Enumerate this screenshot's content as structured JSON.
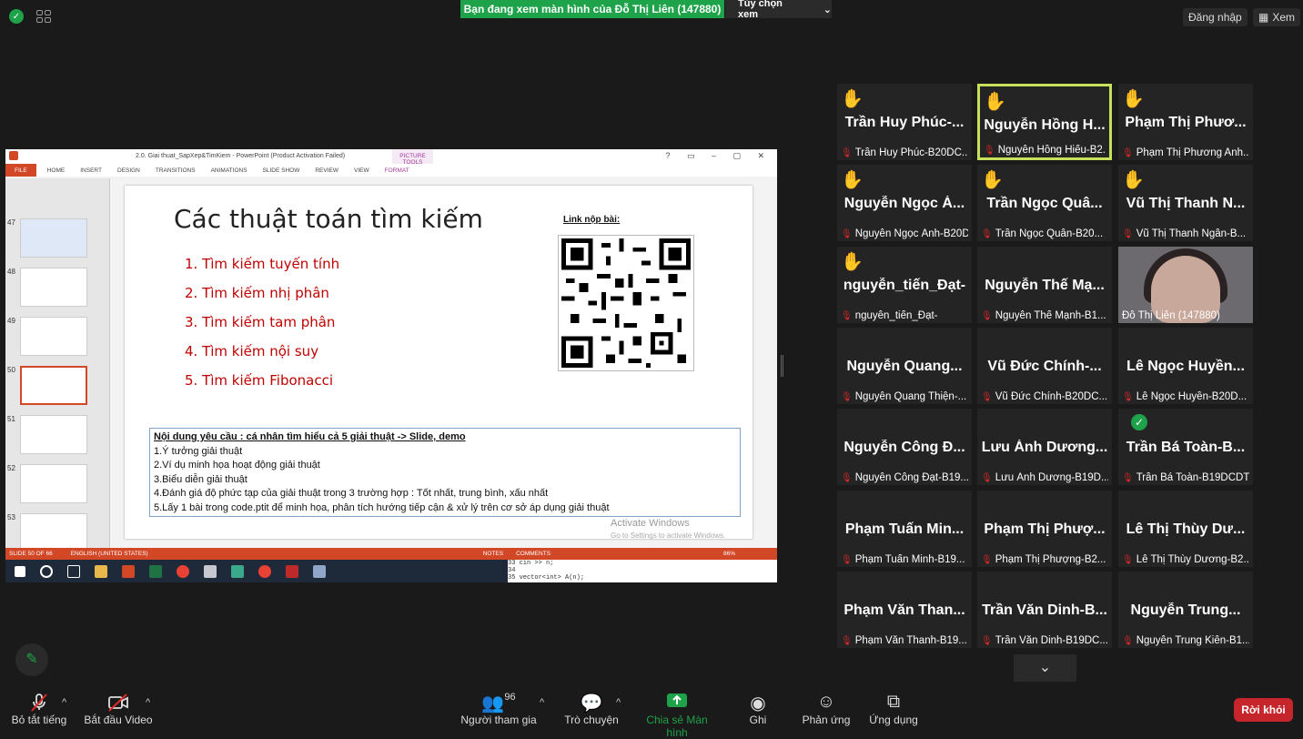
{
  "topbar": {
    "viewing_text": "Bạn đang xem màn hình của Đỗ Thị Liên (147880)",
    "view_options": "Tùy chọn xem",
    "sign_in": "Đăng nhập",
    "view": "Xem"
  },
  "powerpoint": {
    "title": "2.0. Giai thuat_SapXep&TimKiem - PowerPoint (Product Activation Failed)",
    "picture_tools": "PICTURE TOOLS",
    "ribbon": [
      "FILE",
      "HOME",
      "INSERT",
      "DESIGN",
      "TRANSITIONS",
      "ANIMATIONS",
      "SLIDE SHOW",
      "REVIEW",
      "VIEW",
      "FORMAT"
    ],
    "thumb_numbers": [
      "47",
      "48",
      "49",
      "50",
      "51",
      "52",
      "53"
    ],
    "slide": {
      "title": "Các thuật toán tìm kiếm",
      "items": [
        "1. Tìm kiếm tuyến tính",
        "2. Tìm kiếm nhị phân",
        "3. Tìm kiếm tam phân",
        "4. Tìm kiếm nội suy",
        "5. Tìm kiếm Fibonacci"
      ],
      "link_label": "Link nộp bài:",
      "requirements_title": "Nội dung yêu cầu : cá nhân tìm hiểu cả 5 giải thuật -> Slide, demo",
      "requirements": [
        "1.Ý tưởng giải thuật",
        "2.Ví dụ minh họa hoạt động giải thuật",
        "3.Biểu diễn giải thuật",
        "4.Đánh giá độ phức tạp của giải thuật trong 3 trường hợp : Tốt nhất, trung bình, xấu nhất",
        "5.Lấy 1 bài trong code.ptit để minh họa, phân tích hướng tiếp cận & xử lý trên cơ sở áp dụng giải thuật"
      ]
    },
    "activate": "Activate Windows",
    "activate_sub": "Go to Settings to activate Windows.",
    "status_left": "SLIDE 50 OF 66",
    "status_lang": "ENGLISH (UNITED STATES)",
    "status_notes": "NOTES",
    "status_comments": "COMMENTS",
    "zoom": "86%",
    "code_lines": [
      "33      cin >> n;",
      "34",
      "35      vector<int> A(n);"
    ]
  },
  "participants": [
    {
      "big": "Trần Huy Phúc-...",
      "small": "Trần Huy Phúc-B20DC...",
      "hand": true
    },
    {
      "big": "Nguyễn Hồng H...",
      "small": "Nguyễn Hồng Hiếu-B2...",
      "hand": true,
      "active": true
    },
    {
      "big": "Phạm Thị Phươ...",
      "small": "Phạm Thị Phương Anh...",
      "hand": true
    },
    {
      "big": "Nguyễn Ngọc Á...",
      "small": "Nguyễn Ngọc Ánh-B20DC...",
      "hand": true
    },
    {
      "big": "Trần Ngọc Quâ...",
      "small": "Trần Ngọc Quân-B20...",
      "hand": true
    },
    {
      "big": "Vũ Thị Thanh N...",
      "small": "Vũ Thị Thanh Ngân-B...",
      "hand": true
    },
    {
      "big": "nguyễn_tiến_Đạt-",
      "small": "nguyễn_tiến_Đạt-",
      "hand": true
    },
    {
      "big": "Nguyễn Thế Mạ...",
      "small": "Nguyễn Thế Mạnh-B1..."
    },
    {
      "big": "",
      "small": "Đỗ Thị Liên (147880)",
      "video": true
    },
    {
      "big": "Nguyễn Quang...",
      "small": "Nguyễn Quang Thiện-..."
    },
    {
      "big": "Vũ Đức Chính-...",
      "small": "Vũ Đức Chính-B20DC..."
    },
    {
      "big": "Lê Ngọc Huyền...",
      "small": "Lê Ngọc Huyền-B20D..."
    },
    {
      "big": "Nguyễn Công Đ...",
      "small": "Nguyễn Công Đạt-B19..."
    },
    {
      "big": "Lưu Ánh Dương...",
      "small": "Lưu Ánh Dương-B19D..."
    },
    {
      "big": "Trần Bá Toàn-B...",
      "small": "Trần Bá Toàn-B19DCDT...",
      "check": true
    },
    {
      "big": "Phạm Tuấn Min...",
      "small": "Phạm Tuấn Minh-B19..."
    },
    {
      "big": "Phạm Thị Phượ...",
      "small": "Phạm Thị Phượng-B2..."
    },
    {
      "big": "Lê Thị Thùy Dư...",
      "small": "Lê Thị Thùy Dương-B2..."
    },
    {
      "big": "Phạm Văn Than...",
      "small": "Phạm Văn Thanh-B19..."
    },
    {
      "big": "Trần Văn Dinh-B...",
      "small": "Trần Văn Dinh-B19DC..."
    },
    {
      "big": "Nguyễn Trung...",
      "small": "Nguyễn Trung Kiên-B1..."
    }
  ],
  "toolbar": {
    "mute": "Bỏ tắt tiếng",
    "video": "Bắt đầu Video",
    "participants": "Người tham gia",
    "participants_count": "96",
    "chat": "Trò chuyện",
    "share": "Chia sẻ Màn hình",
    "record": "Ghi",
    "reactions": "Phản ứng",
    "apps": "Ứng dụng",
    "leave": "Rời khỏi"
  }
}
